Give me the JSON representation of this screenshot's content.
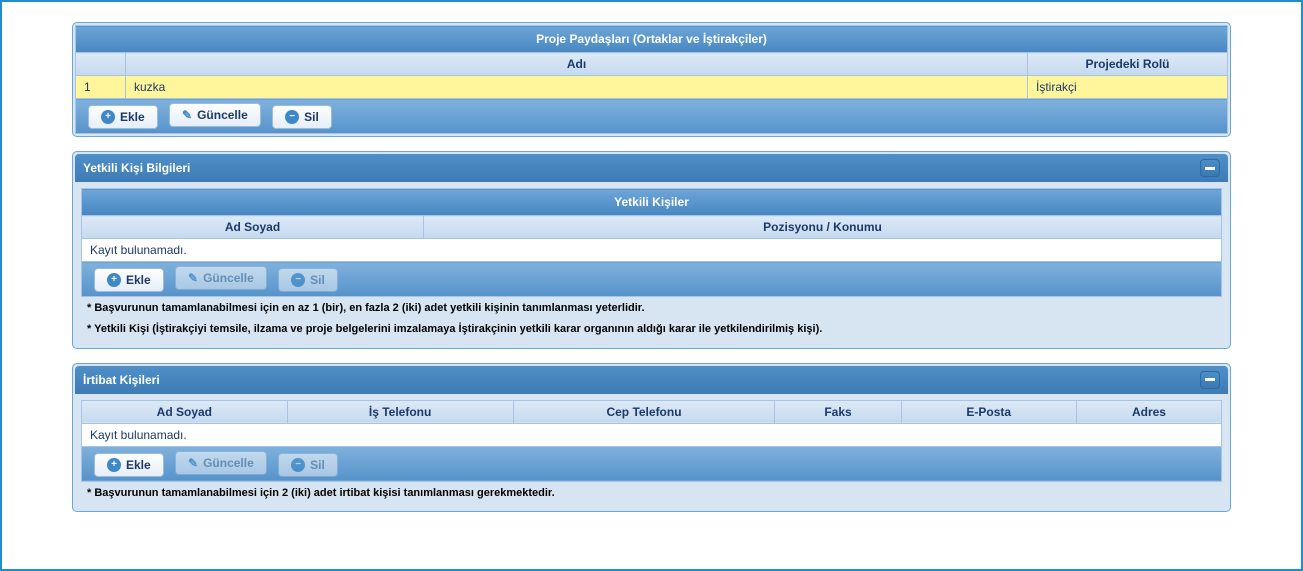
{
  "paydaslar": {
    "title": "Proje Paydaşları (Ortaklar ve İştirakçiler)",
    "columns": {
      "seq": "",
      "adi": "Adı",
      "rol": "Projedeki Rolü"
    },
    "rows": [
      {
        "seq": "1",
        "adi": "kuzka",
        "rol": "İştirakçi"
      }
    ],
    "buttons": {
      "ekle": "Ekle",
      "guncelle": "Güncelle",
      "sil": "Sil"
    }
  },
  "yetkili": {
    "panel_title": "Yetkili Kişi Bilgileri",
    "grid_title": "Yetkili Kişiler",
    "columns": {
      "adsoyad": "Ad Soyad",
      "pozisyon": "Pozisyonu / Konumu"
    },
    "empty_text": "Kayıt bulunamadı.",
    "buttons": {
      "ekle": "Ekle",
      "guncelle": "Güncelle",
      "sil": "Sil"
    },
    "notes": [
      "* Başvurunun tamamlanabilmesi için en az 1 (bir), en fazla 2 (iki) adet yetkili kişinin tanımlanması yeterlidir.",
      "* Yetkili Kişi (İştirakçiyi temsile, ilzama ve proje belgelerini imzalamaya İştirakçinin yetkili karar organının aldığı karar ile yetkilendirilmiş kişi)."
    ]
  },
  "irtibat": {
    "panel_title": "İrtibat Kişileri",
    "columns": {
      "adsoyad": "Ad Soyad",
      "istel": "İş Telefonu",
      "ceptel": "Cep Telefonu",
      "faks": "Faks",
      "eposta": "E-Posta",
      "adres": "Adres"
    },
    "empty_text": "Kayıt bulunamadı.",
    "buttons": {
      "ekle": "Ekle",
      "guncelle": "Güncelle",
      "sil": "Sil"
    },
    "notes": [
      "* Başvurunun tamamlanabilmesi için 2 (iki) adet irtibat kişisi tanımlanması gerekmektedir."
    ]
  }
}
